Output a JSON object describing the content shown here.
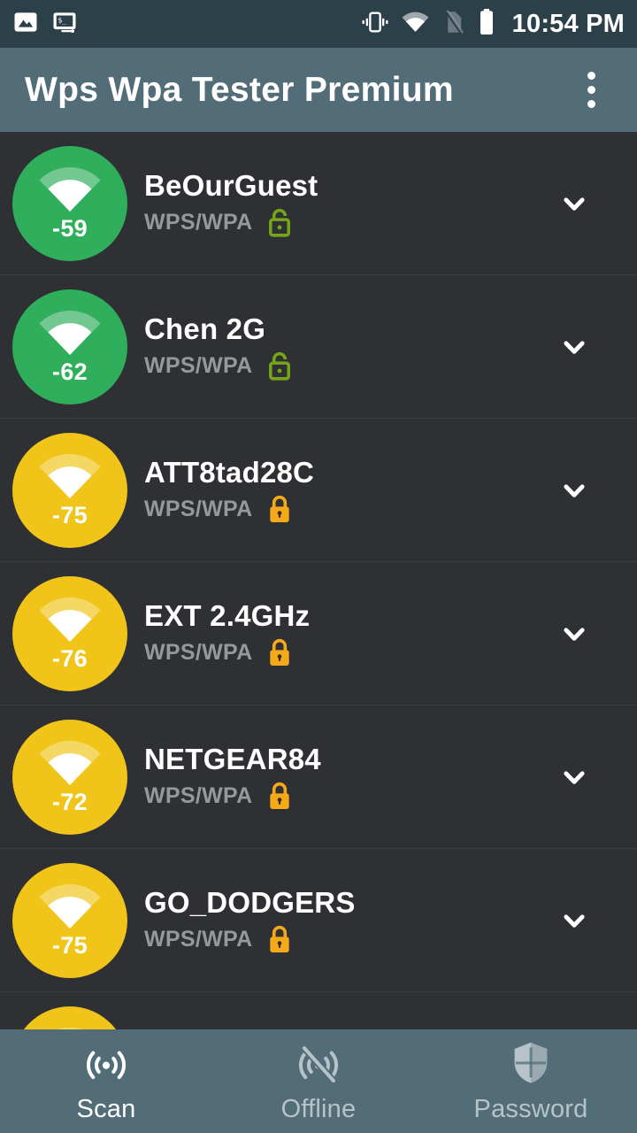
{
  "status_bar": {
    "time": "10:54 PM",
    "left_icons": [
      "image-icon",
      "terminal-icon"
    ],
    "right_icons": [
      "vibrate-icon",
      "wifi-icon",
      "no-sim-icon",
      "battery-icon"
    ],
    "background_color": "#2c4049"
  },
  "app_bar": {
    "title": "Wps Wpa Tester Premium",
    "overflow_icon": "more-vertical-icon",
    "background_color": "#526d78"
  },
  "colors": {
    "page_background": "#2e3033",
    "divider": "#3b3e41",
    "signal_strong": "#2fae5c",
    "signal_medium": "#f0c418",
    "lock_open_green": "#76a618",
    "lock_closed_orange": "#f4a91b",
    "primary_text": "#ffffff",
    "secondary_text": "#94999d",
    "nav_inactive_text": "#b7c3c9"
  },
  "networks": [
    {
      "ssid": "BeOurGuest",
      "security": "WPS/WPA",
      "signal": "-59",
      "strength": "strong",
      "lock": "open",
      "lock_color": "#76a618",
      "circle_color": "#2fae5c",
      "expand_icon": "chevron-down-icon"
    },
    {
      "ssid": "Chen 2G",
      "security": "WPS/WPA",
      "signal": "-62",
      "strength": "strong",
      "lock": "open",
      "lock_color": "#76a618",
      "circle_color": "#2fae5c",
      "expand_icon": "chevron-down-icon"
    },
    {
      "ssid": "ATT8tad28C",
      "security": "WPS/WPA",
      "signal": "-75",
      "strength": "medium",
      "lock": "closed",
      "lock_color": "#f4a91b",
      "circle_color": "#f0c418",
      "expand_icon": "chevron-down-icon"
    },
    {
      "ssid": "EXT 2.4GHz",
      "security": "WPS/WPA",
      "signal": "-76",
      "strength": "medium",
      "lock": "closed",
      "lock_color": "#f4a91b",
      "circle_color": "#f0c418",
      "expand_icon": "chevron-down-icon"
    },
    {
      "ssid": "NETGEAR84",
      "security": "WPS/WPA",
      "signal": "-72",
      "strength": "medium",
      "lock": "closed",
      "lock_color": "#f4a91b",
      "circle_color": "#f0c418",
      "expand_icon": "chevron-down-icon"
    },
    {
      "ssid": "GO_DODGERS",
      "security": "WPS/WPA",
      "signal": "-75",
      "strength": "medium",
      "lock": "closed",
      "lock_color": "#f4a91b",
      "circle_color": "#f0c418",
      "expand_icon": "chevron-down-icon"
    },
    {
      "ssid": "",
      "security": "",
      "signal": "",
      "strength": "medium",
      "lock": "none",
      "lock_color": "#f4a91b",
      "circle_color": "#f0c418",
      "expand_icon": ""
    }
  ],
  "bottom_nav": {
    "items": [
      {
        "label": "Scan",
        "icon": "radar-icon",
        "active": true
      },
      {
        "label": "Offline",
        "icon": "radar-off-icon",
        "active": false
      },
      {
        "label": "Password",
        "icon": "shield-icon",
        "active": false
      }
    ]
  }
}
